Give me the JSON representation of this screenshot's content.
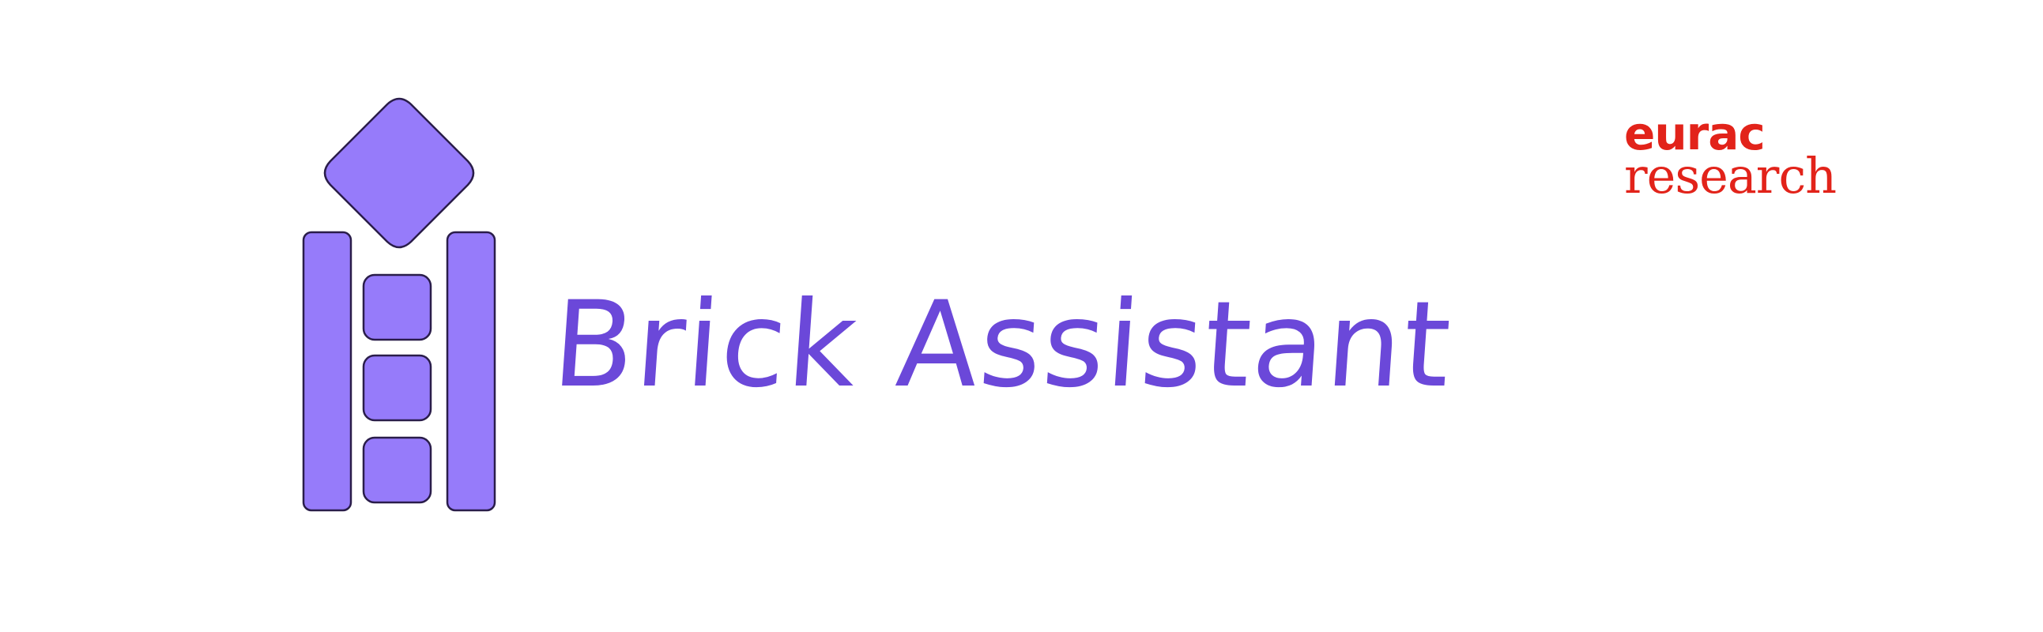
{
  "app": {
    "title": "Brick Assistant",
    "title_color": "#6b48d9"
  },
  "brand_icon": {
    "name": "brick-tower-icon",
    "fill_color": "#967bfa",
    "stroke_color": "#2a1d4a"
  },
  "organization": {
    "line1": "eurac",
    "line2": "research",
    "color": "#e2231a"
  },
  "background_color": "#ffffff"
}
